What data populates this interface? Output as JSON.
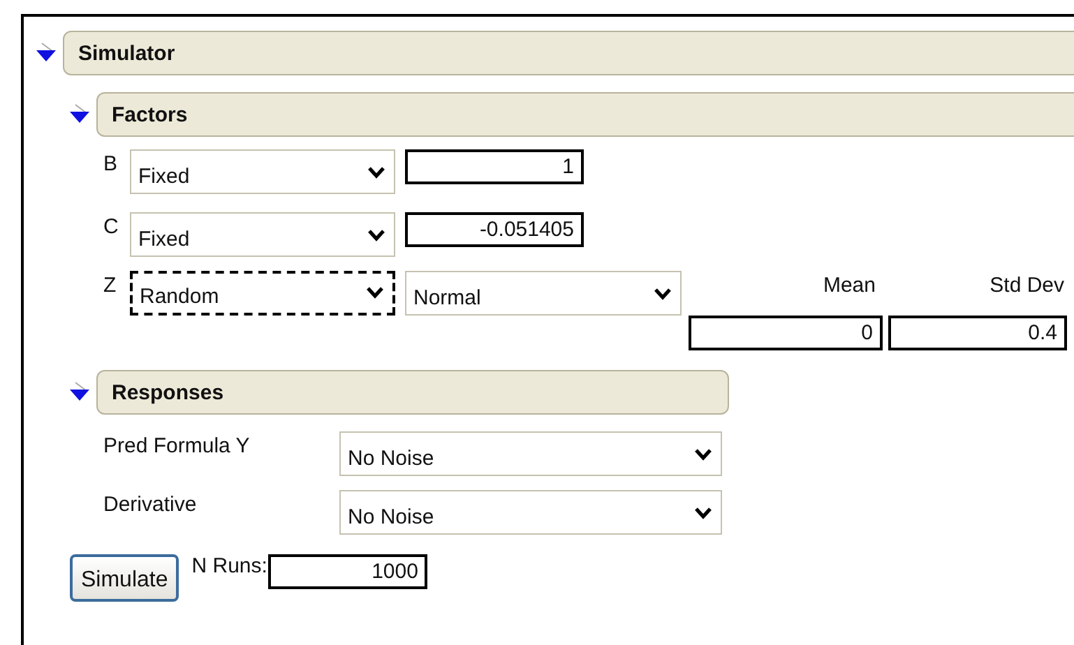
{
  "simulator": {
    "title": "Simulator",
    "expanded": true,
    "factors": {
      "title": "Factors",
      "expanded": true,
      "columns": [
        "Mean",
        "Std Dev"
      ],
      "rows": [
        {
          "name": "B",
          "kind": "fixed",
          "mode": "Fixed",
          "focused": false,
          "value": "1"
        },
        {
          "name": "C",
          "kind": "fixed",
          "mode": "Fixed",
          "focused": false,
          "value": "-0.051405"
        },
        {
          "name": "Z",
          "kind": "random",
          "mode": "Random",
          "focused": true,
          "distribution": "Normal",
          "params": [
            "0",
            "0.4"
          ]
        }
      ]
    },
    "responses": {
      "title": "Responses",
      "expanded": true,
      "rows": [
        {
          "name": "Pred Formula Y",
          "noise": "No Noise"
        },
        {
          "name": "Derivative",
          "noise": "No Noise"
        }
      ]
    },
    "simulate_button": "Simulate",
    "n_runs_label": "N Runs:",
    "n_runs": "1000"
  }
}
